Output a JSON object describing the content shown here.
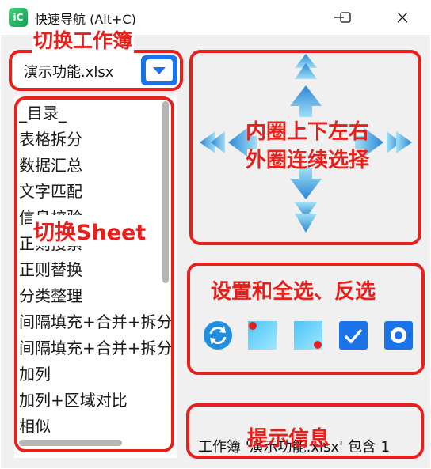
{
  "window": {
    "title": "快速导航 (Alt+C)",
    "app_icon_text": "iC",
    "controls": [
      "minimize",
      "maximize",
      "close"
    ]
  },
  "workbook_selector": {
    "value": "演示功能.xlsx",
    "dropdown_icon": "chevron-down-icon",
    "annotation": "切换工作簿"
  },
  "sheet_list": {
    "items": [
      "_目录_",
      "表格拆分",
      "数据汇总",
      "文字匹配",
      "信息校验",
      "正则搜索",
      "正则替换",
      "分类整理",
      "间隔填充+合并+拆分",
      "间隔填充+合并+拆分",
      "加列",
      "加列+区域对比",
      "相似"
    ],
    "annotation": "切换Sheet"
  },
  "navigation": {
    "annotation_line1": "内圈上下左右",
    "annotation_line2": "外圈连续选择",
    "icons": [
      "arrow-up-outer",
      "arrow-up-inner",
      "arrow-down-inner",
      "arrow-down-outer",
      "arrow-left-outer",
      "arrow-left-inner",
      "arrow-right-inner",
      "arrow-right-outer"
    ]
  },
  "options": {
    "annotation": "设置和全选、反选",
    "icons": [
      "refresh-icon",
      "select-top-left-icon",
      "select-bottom-right-icon",
      "checkbox-checked-icon",
      "radio-icon"
    ]
  },
  "info": {
    "text": "工作簿 '演示功能.xlsx' 包含 1",
    "annotation": "提示信息"
  },
  "colors": {
    "accent": "#1a73e8",
    "annotation_red": "#e8201c",
    "arrow_light": "#8fd6f4",
    "arrow_dark": "#2f88d6"
  }
}
